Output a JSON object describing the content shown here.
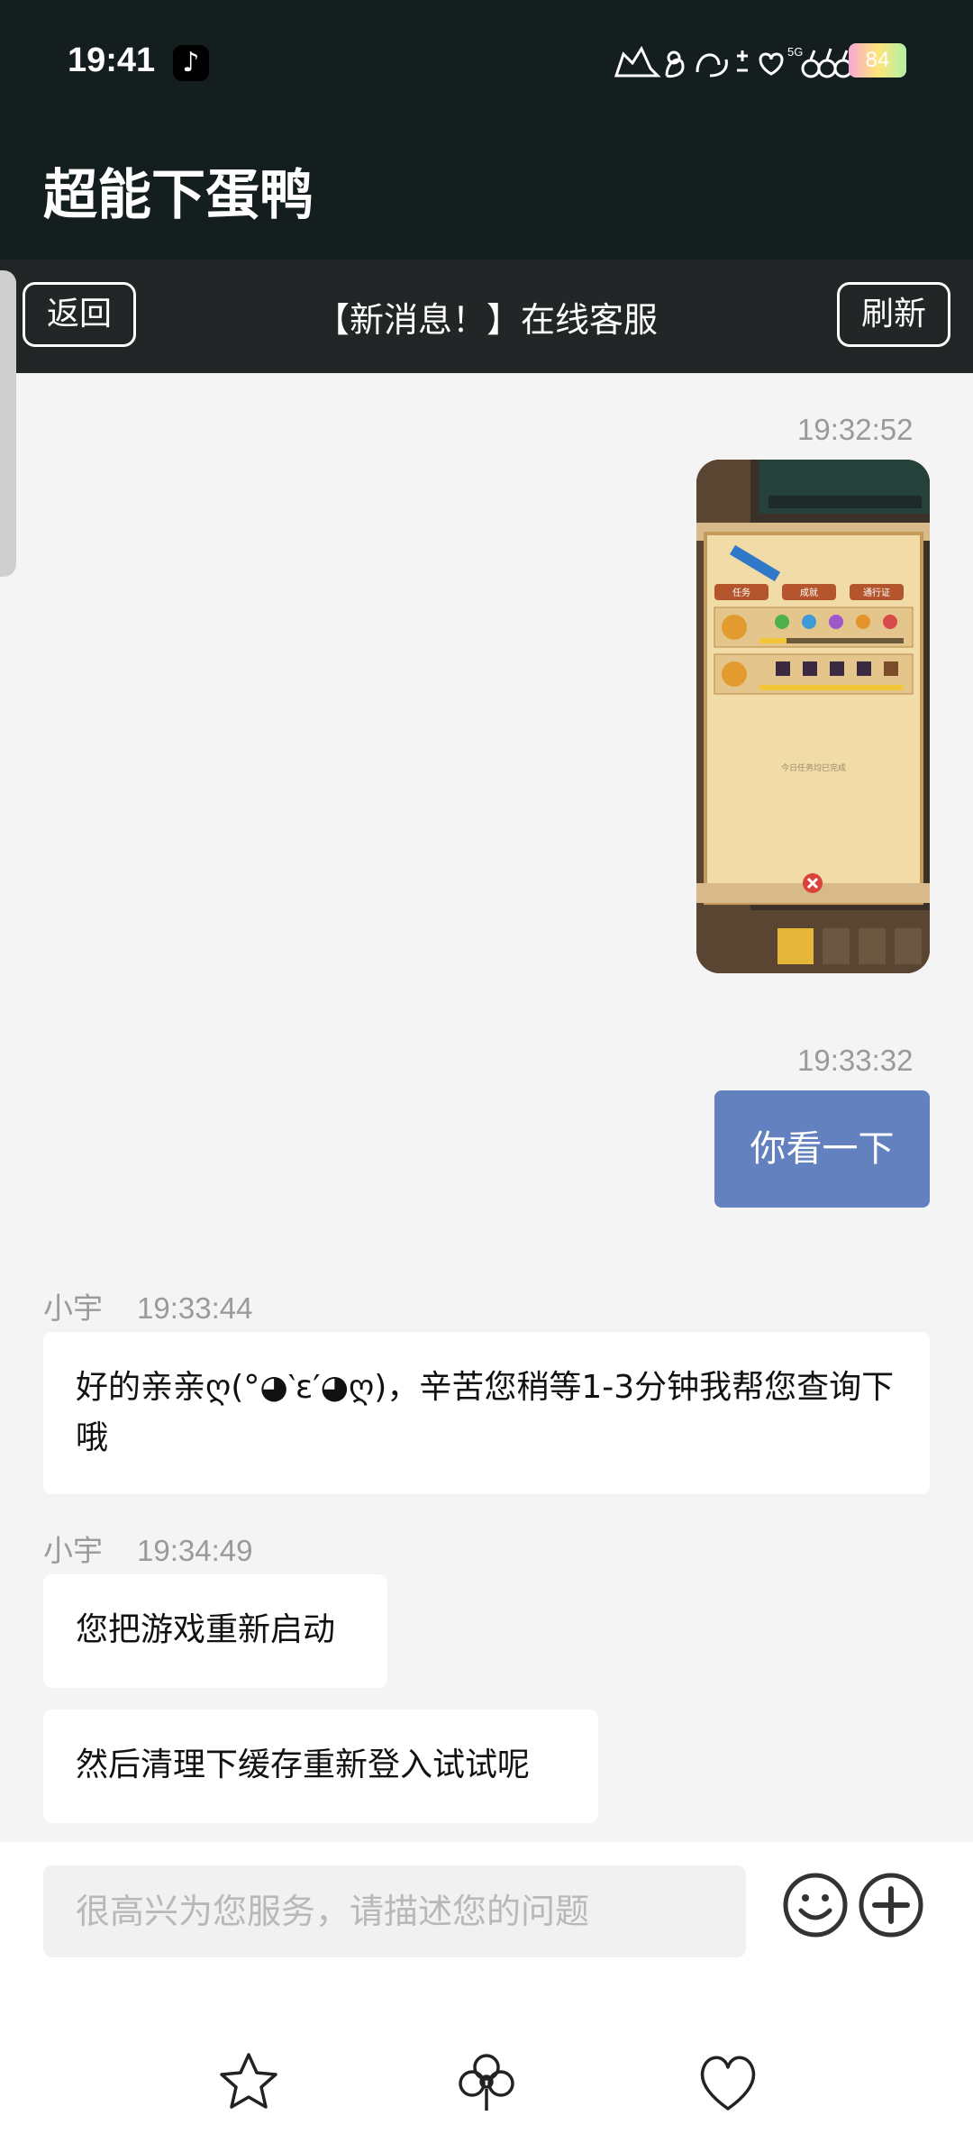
{
  "status_bar": {
    "time": "19:41",
    "battery": "84",
    "network": "5G"
  },
  "app": {
    "title": "超能下蛋鸭"
  },
  "toolbar": {
    "back_label": "返回",
    "title": "【新消息！】在线客服",
    "refresh_label": "刷新"
  },
  "messages": {
    "m1": {
      "timestamp": "19:32:52"
    },
    "m2": {
      "timestamp": "19:33:32",
      "text": "你看一下"
    },
    "m3": {
      "sender": "小宇",
      "timestamp": "19:33:44",
      "text": "好的亲亲ღ(°◕‵ε′◕ღ)，辛苦您稍等1-3分钟我帮您查询下哦"
    },
    "m4": {
      "sender": "小宇",
      "timestamp": "19:34:49",
      "text": "您把游戏重新启动"
    },
    "m5": {
      "text": "然后清理下缓存重新登入试试呢"
    }
  },
  "screenshot": {
    "tabs": [
      "任务",
      "成就",
      "通行证"
    ],
    "footer_text": "今日任务均已完成"
  },
  "input": {
    "placeholder": "很高兴为您服务，请描述您的问题"
  },
  "nav": {
    "icons": [
      "star-icon",
      "clover-icon",
      "heart-icon"
    ]
  }
}
